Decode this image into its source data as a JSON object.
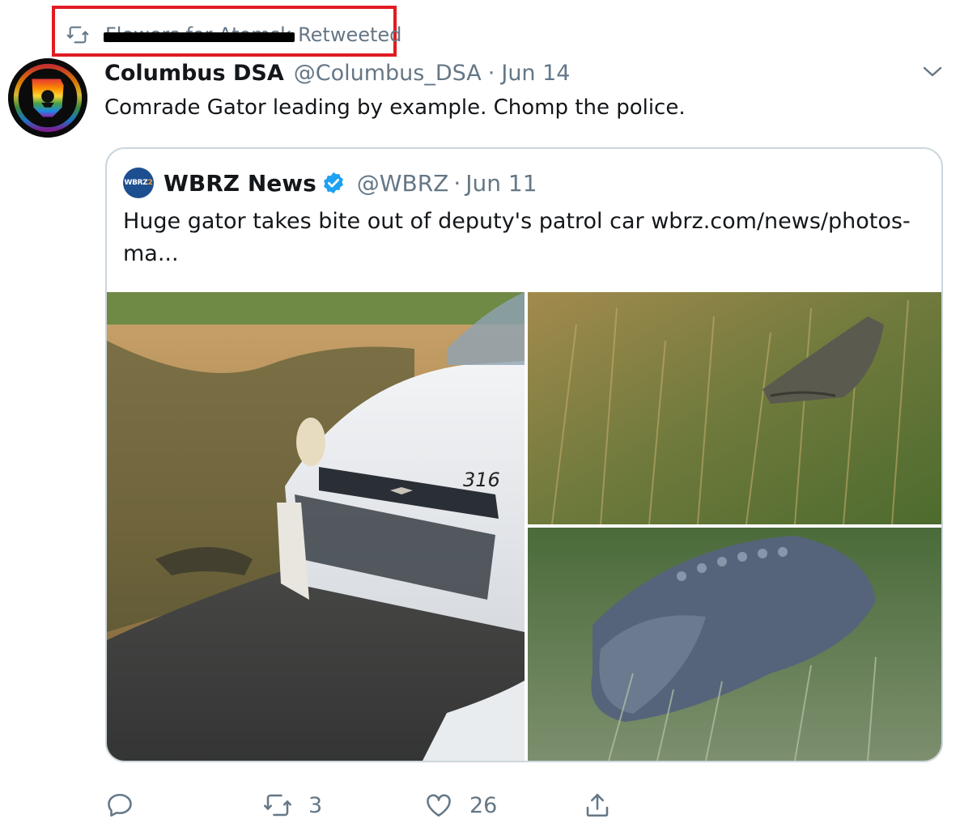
{
  "retweet_context": {
    "name": "Flowers for Atomsk",
    "label": "Retweeted"
  },
  "tweet": {
    "author_name": "Columbus DSA",
    "handle": "@Columbus_DSA",
    "separator": "·",
    "date": "Jun 14",
    "text": "Comrade Gator leading by example. Chomp the police."
  },
  "quoted_tweet": {
    "avatar_text": "WBRZ",
    "avatar_num": "2",
    "author_name": "WBRZ News",
    "handle": "@WBRZ",
    "separator": "·",
    "date": "Jun 11",
    "text": "Huge gator takes bite out of deputy's patrol car wbrz.com/news/photos-ma...",
    "car_number": "316"
  },
  "actions": {
    "reply_count": "",
    "retweet_count": "3",
    "like_count": "26"
  },
  "colors": {
    "secondary_text": "#657786",
    "border": "#ccd6dd",
    "highlight_box": "#e11b22",
    "verified_blue": "#1da1f2"
  },
  "icons": {
    "retweet": "retweet-icon",
    "more": "chevron-down-icon",
    "verified": "verified-badge-icon",
    "reply": "reply-icon",
    "like": "heart-icon",
    "share": "share-icon"
  }
}
